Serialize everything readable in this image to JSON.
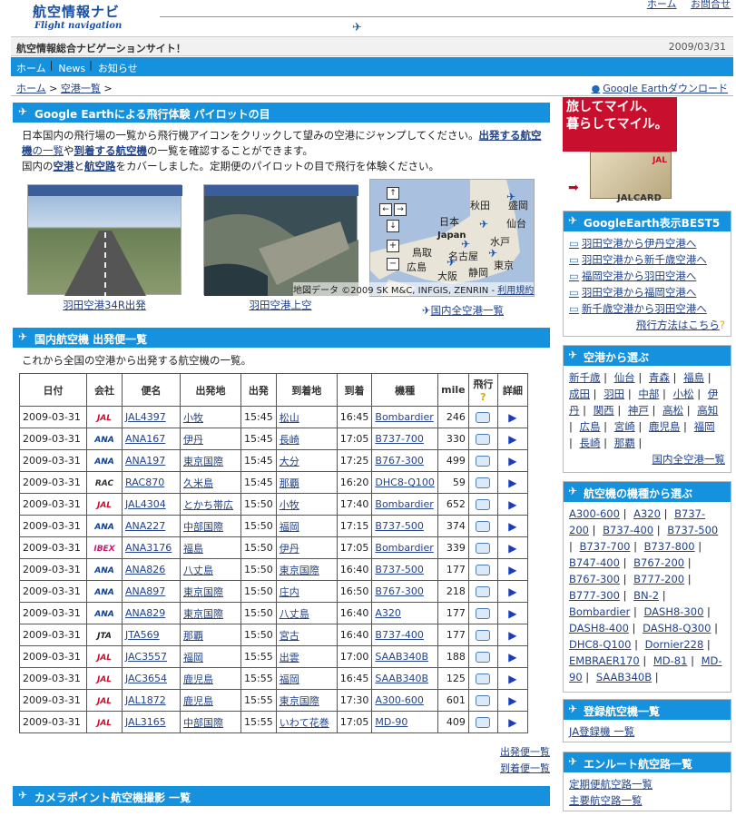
{
  "header": {
    "logo_jp": "航空情報ナビ",
    "logo_en": "Flight navigation",
    "links": [
      "ホーム",
      "お問合せ"
    ],
    "tagline": "航空情報総合ナビゲーションサイト！",
    "date": "2009/03/31"
  },
  "nav": [
    "ホーム",
    "News",
    "お知らせ"
  ],
  "breadcrumb": [
    "ホーム",
    "空港一覧"
  ],
  "ge_download": "Google Earthダウンロード",
  "ge_section": {
    "title": "Google Earthによる飛行体験 パイロットの目",
    "para1_a": "日本国内の飛行場の一覧から飛行機アイコンをクリックして望みの空港にジャンプしてください。",
    "para1_link1": "出発する航空機",
    "para1_b": "の一覧",
    "para1_c": "や",
    "para1_link2": "到着する航空機",
    "para1_d": "の一覧を確認することができます。",
    "para2_a": "国内の",
    "para2_link1": "空港",
    "para2_b": "と",
    "para2_link2": "航空路",
    "para2_c": "をカバーしました。定期便のパイロットの目で飛行を体験ください。",
    "captions": [
      "羽田空港34R出発",
      "羽田空港上空",
      "国内全空港一覧"
    ],
    "map_labels": [
      "秋田",
      "盛岡",
      "日本",
      "仙台",
      "Japan",
      "水戸",
      "鳥取",
      "名古屋",
      "広島",
      "静岡",
      "東京",
      "大阪"
    ],
    "map_credit": "地図データ ©2009 SK M&C, INFGIS, ZENRIN",
    "map_terms": "利用規約"
  },
  "departures": {
    "title": "国内航空機 出発便一覧",
    "intro": "これから全国の空港から出発する航空機の一覧。",
    "columns": [
      "日付",
      "会社",
      "便名",
      "出発地",
      "出発",
      "到着地",
      "到着",
      "機種",
      "mile",
      "飛行",
      "詳細"
    ],
    "rows": [
      [
        "2009-03-31",
        "JAL",
        "JAL4397",
        "小牧",
        "15:45",
        "松山",
        "16:45",
        "Bombardier",
        "246"
      ],
      [
        "2009-03-31",
        "ANA",
        "ANA167",
        "伊丹",
        "15:45",
        "長崎",
        "17:05",
        "B737-700",
        "330"
      ],
      [
        "2009-03-31",
        "ANA",
        "ANA197",
        "東京国際",
        "15:45",
        "大分",
        "17:25",
        "B767-300",
        "499"
      ],
      [
        "2009-03-31",
        "RAC",
        "RAC870",
        "久米島",
        "15:45",
        "那覇",
        "16:20",
        "DHC8-Q100",
        "59"
      ],
      [
        "2009-03-31",
        "JAL",
        "JAL4304",
        "とかち帯広",
        "15:50",
        "小牧",
        "17:40",
        "Bombardier",
        "652"
      ],
      [
        "2009-03-31",
        "ANA",
        "ANA227",
        "中部国際",
        "15:50",
        "福岡",
        "17:15",
        "B737-500",
        "374"
      ],
      [
        "2009-03-31",
        "IBEX",
        "ANA3176",
        "福島",
        "15:50",
        "伊丹",
        "17:05",
        "Bombardier",
        "339"
      ],
      [
        "2009-03-31",
        "ANA",
        "ANA826",
        "八丈島",
        "15:50",
        "東京国際",
        "16:40",
        "B737-500",
        "177"
      ],
      [
        "2009-03-31",
        "ANA",
        "ANA897",
        "東京国際",
        "15:50",
        "庄内",
        "16:50",
        "B767-300",
        "218"
      ],
      [
        "2009-03-31",
        "ANA",
        "ANA829",
        "東京国際",
        "15:50",
        "八丈島",
        "16:40",
        "A320",
        "177"
      ],
      [
        "2009-03-31",
        "JTA",
        "JTA569",
        "那覇",
        "15:50",
        "宮古",
        "16:40",
        "B737-400",
        "177"
      ],
      [
        "2009-03-31",
        "JAL",
        "JAC3557",
        "福岡",
        "15:55",
        "出雲",
        "17:00",
        "SAAB340B",
        "188"
      ],
      [
        "2009-03-31",
        "JAL",
        "JAC3654",
        "鹿児島",
        "15:55",
        "福岡",
        "16:45",
        "SAAB340B",
        "125"
      ],
      [
        "2009-03-31",
        "JAL",
        "JAL1872",
        "鹿児島",
        "15:55",
        "東京国際",
        "17:30",
        "A300-600",
        "601"
      ],
      [
        "2009-03-31",
        "JAL",
        "JAL3165",
        "中部国際",
        "15:55",
        "いわて花巻",
        "17:05",
        "MD-90",
        "409"
      ]
    ],
    "links": [
      "出発便一覧",
      "到着便一覧"
    ]
  },
  "camera": {
    "title": "カメラポイント航空機撮影 一覧"
  },
  "ad": {
    "line1": "旅してマイル、",
    "line2": "暮らしてマイル。",
    "brand": "JALCARD",
    "card_logo": "JAL"
  },
  "best5": {
    "title": "GoogleEarth表示BEST5",
    "items": [
      "羽田空港から伊丹空港へ",
      "羽田空港から新千歳空港へ",
      "福岡空港から羽田空港へ",
      "羽田空港から福岡空港へ",
      "新千歳空港から羽田空港へ"
    ],
    "howto": "飛行方法はこちら"
  },
  "airports": {
    "title": "空港から選ぶ",
    "items": [
      "新千歳",
      "仙台",
      "青森",
      "福島",
      "成田",
      "羽田",
      "中部",
      "小松",
      "伊丹",
      "関西",
      "神戸",
      "高松",
      "高知",
      "広島",
      "宮崎",
      "鹿児島",
      "福岡",
      "長崎",
      "那覇"
    ],
    "all": "国内全空港一覧"
  },
  "types": {
    "title": "航空機の機種から選ぶ",
    "items": [
      "A300-600",
      "A320",
      "B737-200",
      "B737-400",
      "B737-500",
      "B737-700",
      "B737-800",
      "B747-400",
      "B767-200",
      "B767-300",
      "B777-200",
      "B777-300",
      "BN-2",
      "Bombardier",
      "DASH8-300",
      "DASH8-400",
      "DASH8-Q300",
      "DHC8-Q100",
      "Dornier228",
      "EMBRAER170",
      "MD-81",
      "MD-90",
      "SAAB340B"
    ]
  },
  "registered": {
    "title": "登録航空機一覧",
    "items": [
      "JA登録機 一覧"
    ]
  },
  "enroute": {
    "title": "エンルート航空路一覧",
    "items": [
      "定期便航空路一覧",
      "主要航空路一覧"
    ]
  },
  "colors": {
    "accent": "#1691dd",
    "link": "#22438a",
    "ad_red": "#c8102e"
  }
}
